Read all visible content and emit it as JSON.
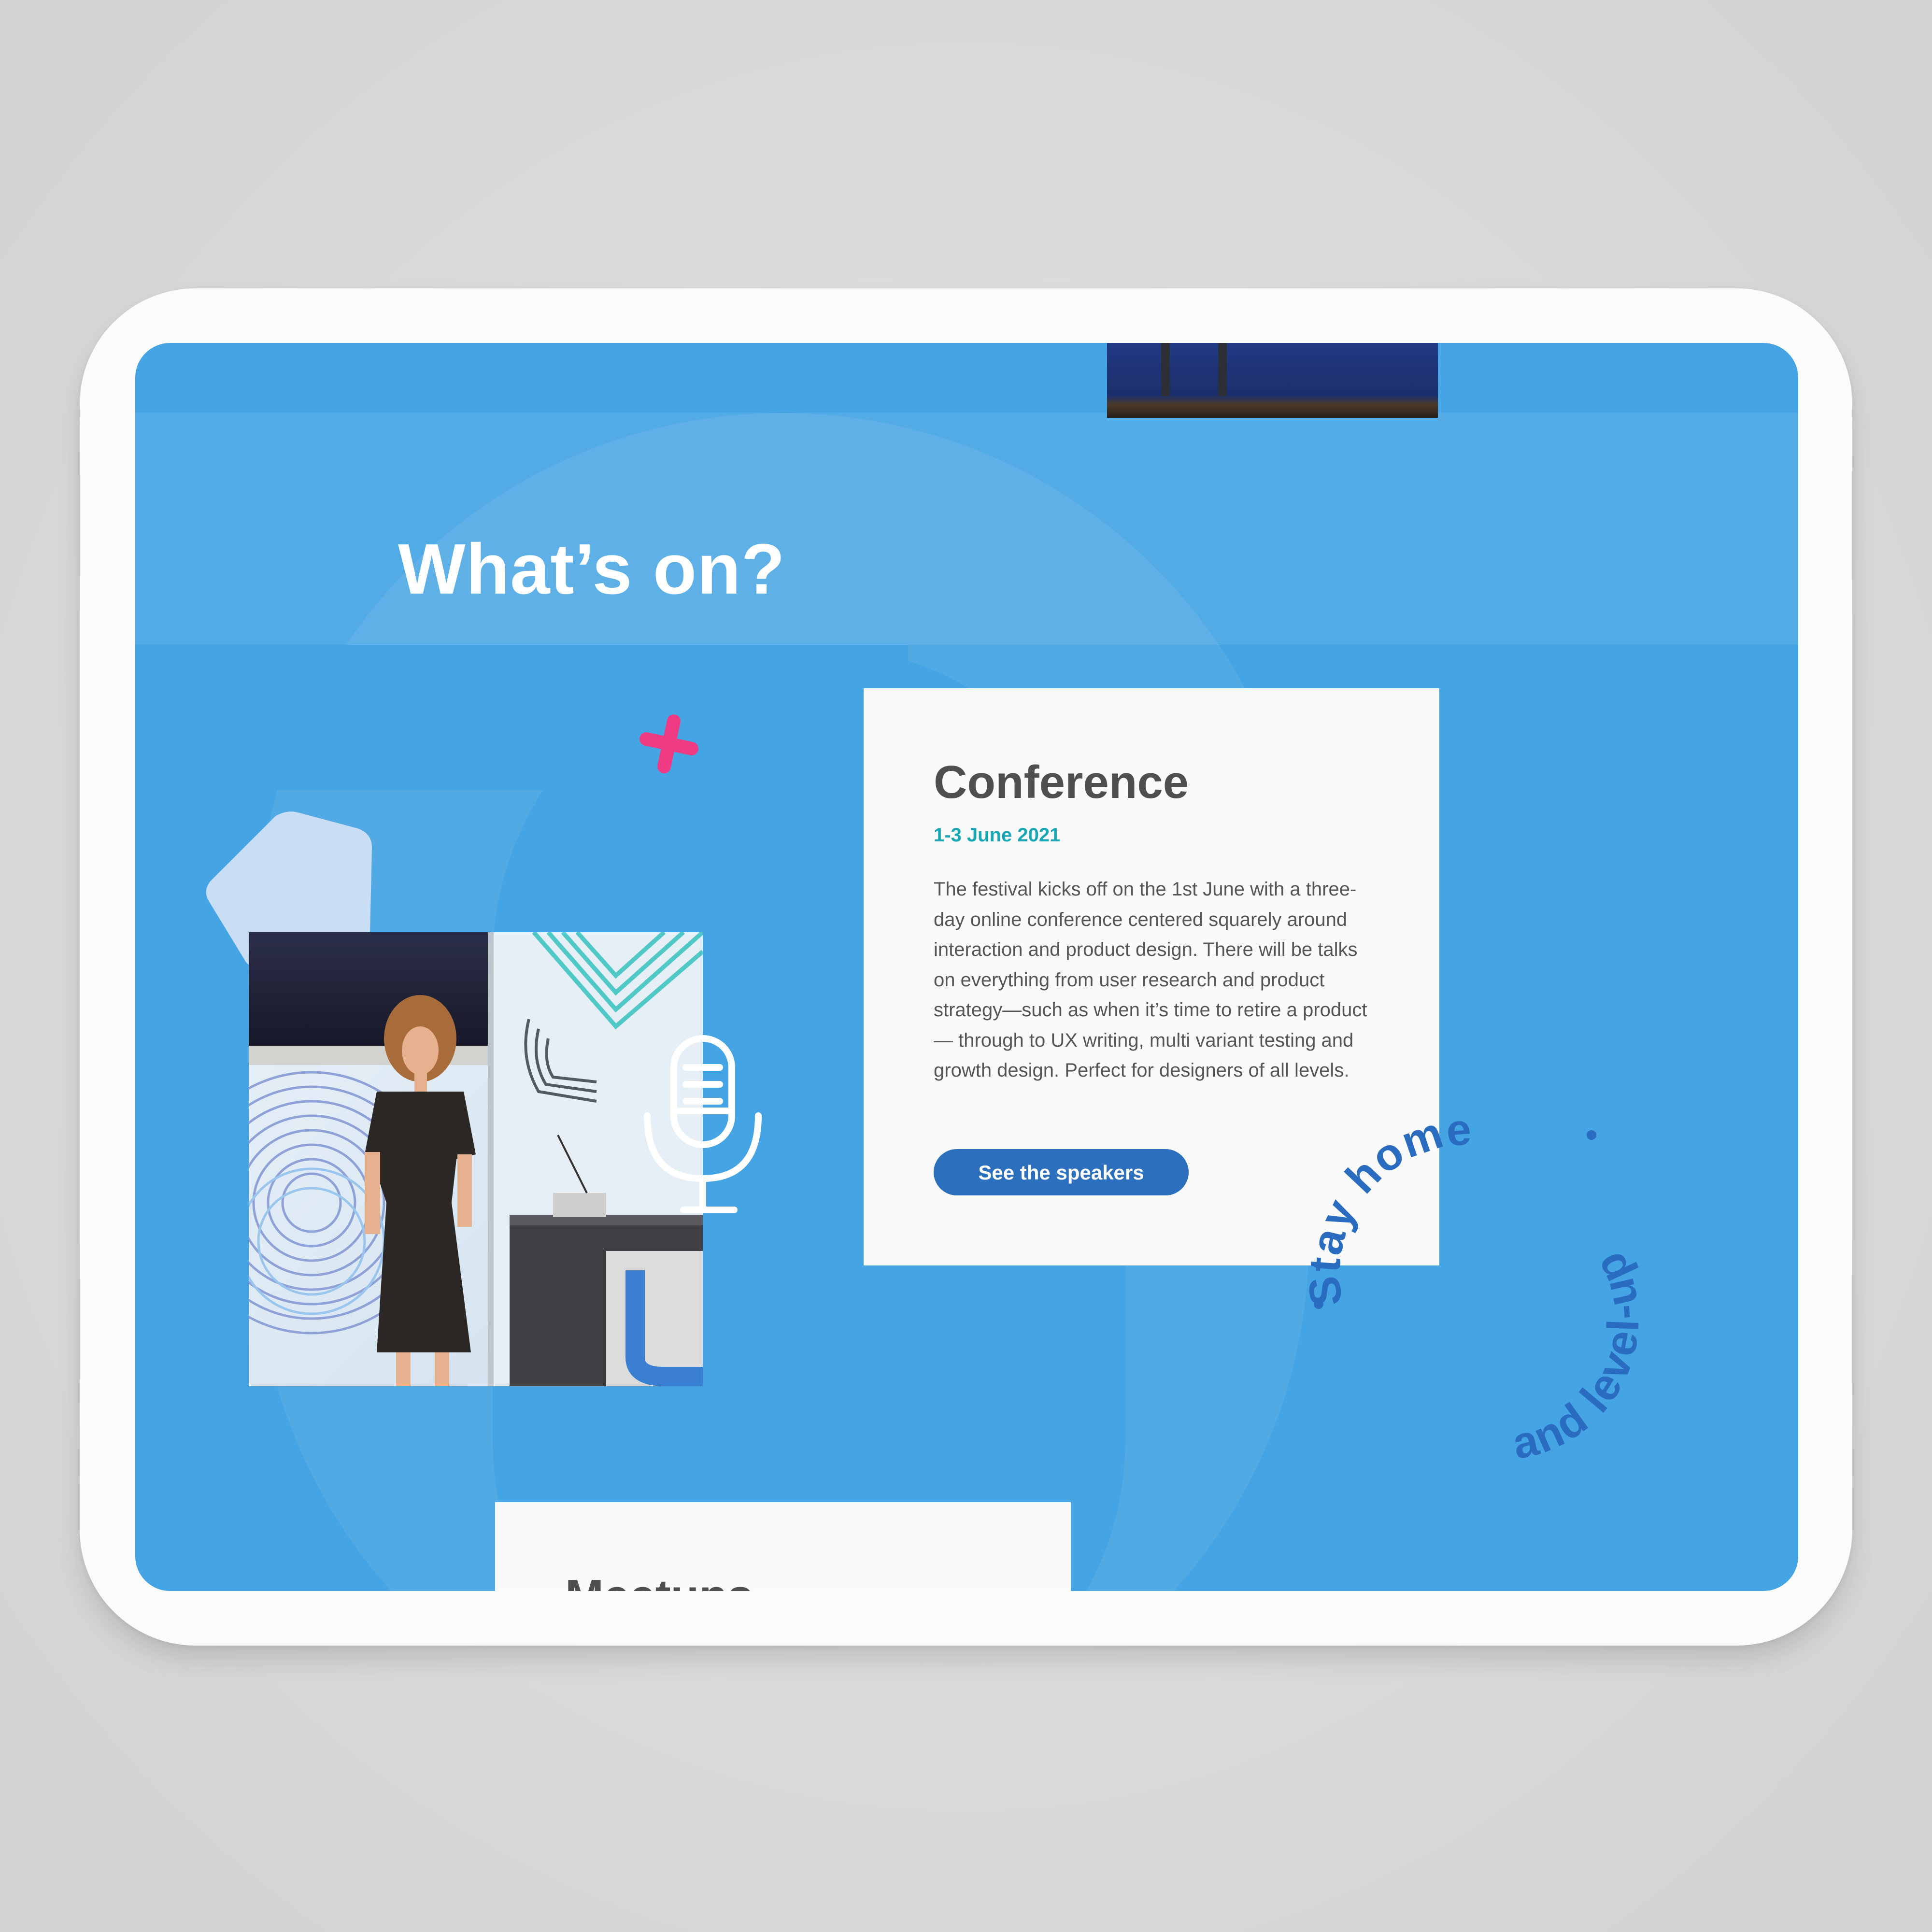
{
  "section": {
    "title": "What’s on?"
  },
  "conference_card": {
    "title": "Conference",
    "date": "1-3 June 2021",
    "description": "The festival kicks off on the 1st June with a three-day online conference centered squarely around interaction and product design. There will be talks on everything from user research and product strategy—such as when it’s time to retire a product— through to UX writing, multi variant testing and growth design. Perfect for designers of all levels.",
    "button_label": "See the speakers"
  },
  "badge": {
    "line1": "Stay home",
    "line2": "and level-up"
  },
  "next_card": {
    "title": "Meetups"
  },
  "colors": {
    "screen_background": "#45a4e4",
    "accent_pink": "#ef3b83",
    "date_teal": "#19a7b6",
    "button_blue": "#2b6fbd",
    "badge_blue": "#2a6cc0"
  },
  "icons": [
    "cross-icon",
    "microphone-icon",
    "pentagon-shape"
  ]
}
